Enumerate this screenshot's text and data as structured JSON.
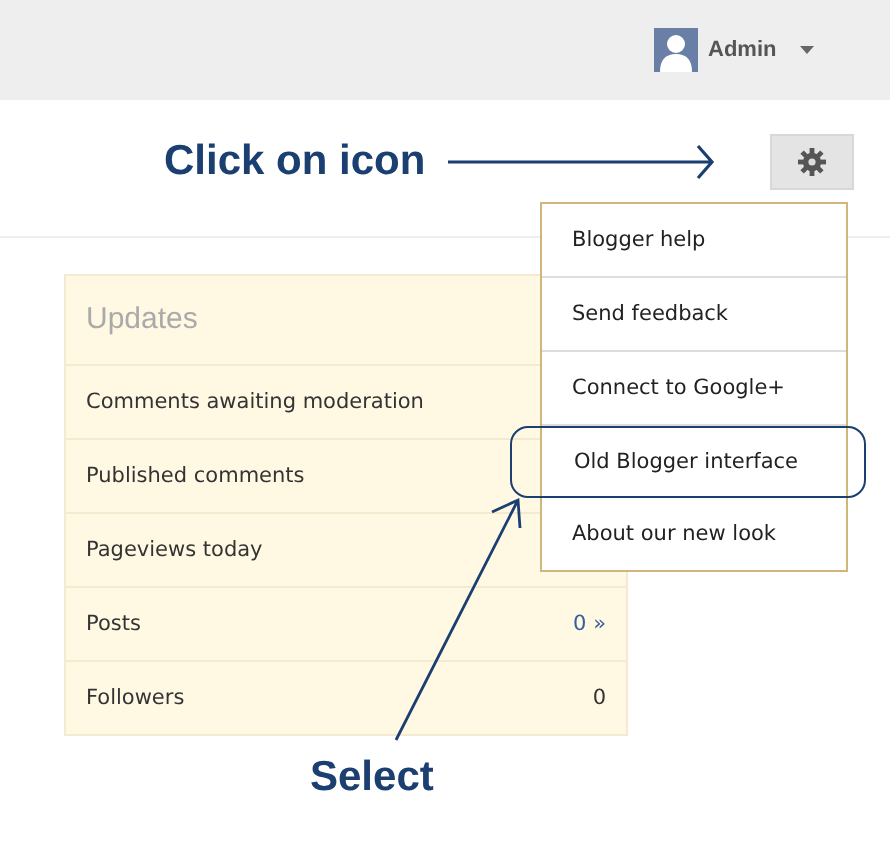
{
  "header": {
    "user": "Admin"
  },
  "instruction_top": "Click on icon",
  "instruction_bottom": "Select",
  "updates": {
    "title": "Updates",
    "rows": [
      {
        "label": "Comments awaiting moderation"
      },
      {
        "label": "Published comments"
      },
      {
        "label": "Pageviews today"
      },
      {
        "label": "Posts",
        "value": "0 »",
        "link": true
      },
      {
        "label": "Followers",
        "value": "0",
        "link": false
      }
    ]
  },
  "menu": {
    "items": [
      {
        "label": "Blogger help",
        "highlighted": false
      },
      {
        "label": "Send feedback",
        "highlighted": false
      },
      {
        "label": "Connect to Google+",
        "highlighted": false
      },
      {
        "label": "Old Blogger interface",
        "highlighted": true
      },
      {
        "label": "About our new look",
        "highlighted": false
      }
    ]
  }
}
